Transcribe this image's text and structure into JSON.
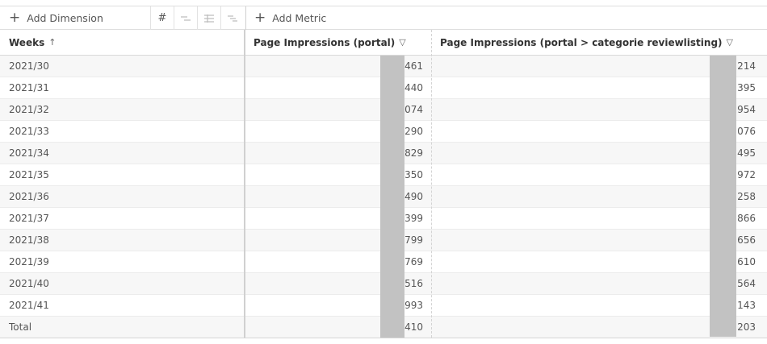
{
  "toolbar": {
    "add_dimension_label": "Add Dimension",
    "hash_glyph": "#",
    "add_metric_label": "Add Metric"
  },
  "table": {
    "headers": {
      "weeks": "Weeks",
      "sort_glyph": "↑",
      "metric1": "Page Impressions (portal)",
      "metric2": "Page Impressions (portal > categorie reviewlisting)",
      "filter_glyph": "▽"
    },
    "rows": [
      {
        "week": "2021/30",
        "v1": ",461",
        "v2": ",214"
      },
      {
        "week": "2021/31",
        "v1": ",440",
        "v2": ",395"
      },
      {
        "week": "2021/32",
        "v1": ",074",
        "v2": ",954"
      },
      {
        "week": "2021/33",
        "v1": ",290",
        "v2": ",076"
      },
      {
        "week": "2021/34",
        "v1": ",829",
        "v2": ",495"
      },
      {
        "week": "2021/35",
        "v1": ",350",
        "v2": ",972"
      },
      {
        "week": "2021/36",
        "v1": ",490",
        "v2": ",258"
      },
      {
        "week": "2021/37",
        "v1": ",399",
        "v2": ",866"
      },
      {
        "week": "2021/38",
        "v1": ",799",
        "v2": ",656"
      },
      {
        "week": "2021/39",
        "v1": ",769",
        "v2": ",610"
      },
      {
        "week": "2021/40",
        "v1": ",516",
        "v2": ",564"
      },
      {
        "week": "2021/41",
        "v1": ",993",
        "v2": ",143"
      }
    ],
    "total": {
      "label": "Total",
      "v1": ",410",
      "v2": ",203"
    }
  }
}
